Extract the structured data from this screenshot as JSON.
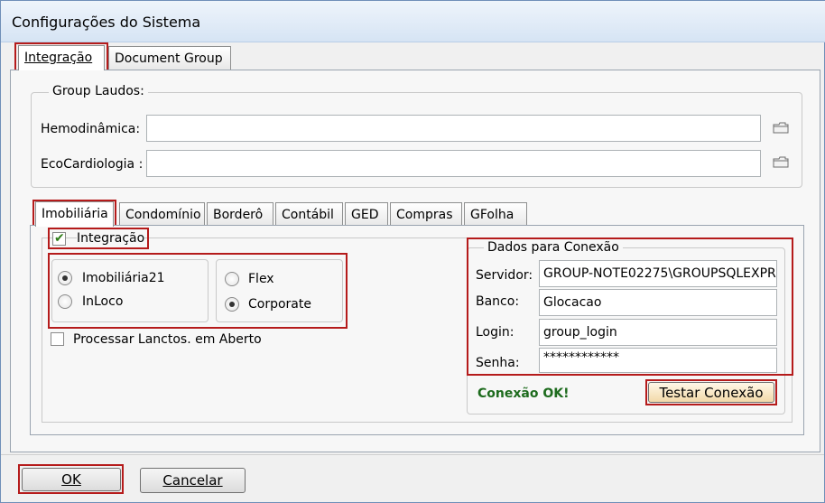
{
  "window": {
    "title": "Configurações do Sistema"
  },
  "top_tabs": [
    "Integração",
    "Document Group"
  ],
  "group_laudos": {
    "legend": "Group Laudos:",
    "fields": [
      {
        "label": "Hemodinâmica:",
        "value": ""
      },
      {
        "label": "EcoCardiologia :",
        "value": ""
      }
    ]
  },
  "sub_tabs": [
    "Imobiliária",
    "Condomínio",
    "Borderô",
    "Contábil",
    "GED",
    "Compras",
    "GFolha"
  ],
  "integracao": {
    "label": "Integração",
    "checked": true
  },
  "radio_group_a": [
    {
      "label": "Imobiliária21",
      "selected": true
    },
    {
      "label": "InLoco",
      "selected": false
    }
  ],
  "radio_group_b": [
    {
      "label": "Flex",
      "selected": false
    },
    {
      "label": "Corporate",
      "selected": true
    }
  ],
  "processar": {
    "label": "Processar Lanctos. em Aberto",
    "checked": false
  },
  "conexao": {
    "legend": "Dados para Conexão",
    "servidor_label": "Servidor:",
    "servidor_value": "GROUP-NOTE02275\\GROUPSQLEXPR",
    "banco_label": "Banco:",
    "banco_value": "Glocacao",
    "login_label": "Login:",
    "login_value": "group_login",
    "senha_label": "Senha:",
    "senha_value": "************",
    "status": "Conexão OK!",
    "test_button": "Testar Conexão",
    "status_color": "#1d6b1d"
  },
  "footer": {
    "ok": "OK",
    "cancel": "Cancelar"
  },
  "colors": {
    "highlight": "#b51b1b"
  },
  "icons": {
    "browse": "folder-icon",
    "check": "checkmark-icon"
  }
}
